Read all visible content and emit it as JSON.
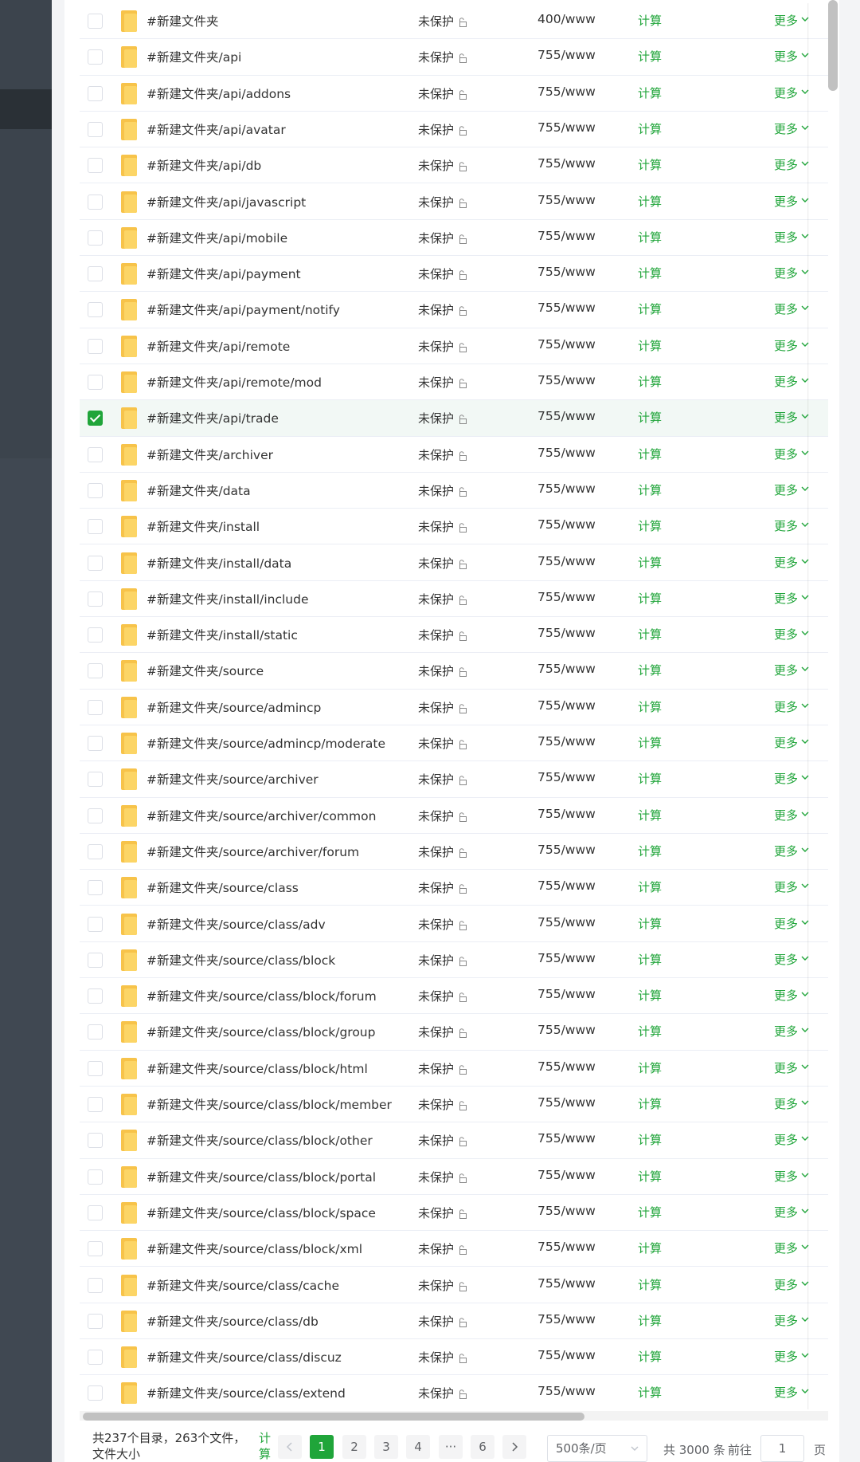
{
  "rows": [
    {
      "name": "#新建文件夹",
      "protection": "未保护",
      "permission": "400/www",
      "calc": "计算",
      "more": "更多",
      "checked": false
    },
    {
      "name": "#新建文件夹/api",
      "protection": "未保护",
      "permission": "755/www",
      "calc": "计算",
      "more": "更多",
      "checked": false
    },
    {
      "name": "#新建文件夹/api/addons",
      "protection": "未保护",
      "permission": "755/www",
      "calc": "计算",
      "more": "更多",
      "checked": false
    },
    {
      "name": "#新建文件夹/api/avatar",
      "protection": "未保护",
      "permission": "755/www",
      "calc": "计算",
      "more": "更多",
      "checked": false
    },
    {
      "name": "#新建文件夹/api/db",
      "protection": "未保护",
      "permission": "755/www",
      "calc": "计算",
      "more": "更多",
      "checked": false
    },
    {
      "name": "#新建文件夹/api/javascript",
      "protection": "未保护",
      "permission": "755/www",
      "calc": "计算",
      "more": "更多",
      "checked": false
    },
    {
      "name": "#新建文件夹/api/mobile",
      "protection": "未保护",
      "permission": "755/www",
      "calc": "计算",
      "more": "更多",
      "checked": false
    },
    {
      "name": "#新建文件夹/api/payment",
      "protection": "未保护",
      "permission": "755/www",
      "calc": "计算",
      "more": "更多",
      "checked": false
    },
    {
      "name": "#新建文件夹/api/payment/notify",
      "protection": "未保护",
      "permission": "755/www",
      "calc": "计算",
      "more": "更多",
      "checked": false
    },
    {
      "name": "#新建文件夹/api/remote",
      "protection": "未保护",
      "permission": "755/www",
      "calc": "计算",
      "more": "更多",
      "checked": false
    },
    {
      "name": "#新建文件夹/api/remote/mod",
      "protection": "未保护",
      "permission": "755/www",
      "calc": "计算",
      "more": "更多",
      "checked": false
    },
    {
      "name": "#新建文件夹/api/trade",
      "protection": "未保护",
      "permission": "755/www",
      "calc": "计算",
      "more": "更多",
      "checked": true
    },
    {
      "name": "#新建文件夹/archiver",
      "protection": "未保护",
      "permission": "755/www",
      "calc": "计算",
      "more": "更多",
      "checked": false
    },
    {
      "name": "#新建文件夹/data",
      "protection": "未保护",
      "permission": "755/www",
      "calc": "计算",
      "more": "更多",
      "checked": false
    },
    {
      "name": "#新建文件夹/install",
      "protection": "未保护",
      "permission": "755/www",
      "calc": "计算",
      "more": "更多",
      "checked": false
    },
    {
      "name": "#新建文件夹/install/data",
      "protection": "未保护",
      "permission": "755/www",
      "calc": "计算",
      "more": "更多",
      "checked": false
    },
    {
      "name": "#新建文件夹/install/include",
      "protection": "未保护",
      "permission": "755/www",
      "calc": "计算",
      "more": "更多",
      "checked": false
    },
    {
      "name": "#新建文件夹/install/static",
      "protection": "未保护",
      "permission": "755/www",
      "calc": "计算",
      "more": "更多",
      "checked": false
    },
    {
      "name": "#新建文件夹/source",
      "protection": "未保护",
      "permission": "755/www",
      "calc": "计算",
      "more": "更多",
      "checked": false
    },
    {
      "name": "#新建文件夹/source/admincp",
      "protection": "未保护",
      "permission": "755/www",
      "calc": "计算",
      "more": "更多",
      "checked": false
    },
    {
      "name": "#新建文件夹/source/admincp/moderate",
      "protection": "未保护",
      "permission": "755/www",
      "calc": "计算",
      "more": "更多",
      "checked": false
    },
    {
      "name": "#新建文件夹/source/archiver",
      "protection": "未保护",
      "permission": "755/www",
      "calc": "计算",
      "more": "更多",
      "checked": false
    },
    {
      "name": "#新建文件夹/source/archiver/common",
      "protection": "未保护",
      "permission": "755/www",
      "calc": "计算",
      "more": "更多",
      "checked": false
    },
    {
      "name": "#新建文件夹/source/archiver/forum",
      "protection": "未保护",
      "permission": "755/www",
      "calc": "计算",
      "more": "更多",
      "checked": false
    },
    {
      "name": "#新建文件夹/source/class",
      "protection": "未保护",
      "permission": "755/www",
      "calc": "计算",
      "more": "更多",
      "checked": false
    },
    {
      "name": "#新建文件夹/source/class/adv",
      "protection": "未保护",
      "permission": "755/www",
      "calc": "计算",
      "more": "更多",
      "checked": false
    },
    {
      "name": "#新建文件夹/source/class/block",
      "protection": "未保护",
      "permission": "755/www",
      "calc": "计算",
      "more": "更多",
      "checked": false
    },
    {
      "name": "#新建文件夹/source/class/block/forum",
      "protection": "未保护",
      "permission": "755/www",
      "calc": "计算",
      "more": "更多",
      "checked": false
    },
    {
      "name": "#新建文件夹/source/class/block/group",
      "protection": "未保护",
      "permission": "755/www",
      "calc": "计算",
      "more": "更多",
      "checked": false
    },
    {
      "name": "#新建文件夹/source/class/block/html",
      "protection": "未保护",
      "permission": "755/www",
      "calc": "计算",
      "more": "更多",
      "checked": false
    },
    {
      "name": "#新建文件夹/source/class/block/member",
      "protection": "未保护",
      "permission": "755/www",
      "calc": "计算",
      "more": "更多",
      "checked": false
    },
    {
      "name": "#新建文件夹/source/class/block/other",
      "protection": "未保护",
      "permission": "755/www",
      "calc": "计算",
      "more": "更多",
      "checked": false
    },
    {
      "name": "#新建文件夹/source/class/block/portal",
      "protection": "未保护",
      "permission": "755/www",
      "calc": "计算",
      "more": "更多",
      "checked": false
    },
    {
      "name": "#新建文件夹/source/class/block/space",
      "protection": "未保护",
      "permission": "755/www",
      "calc": "计算",
      "more": "更多",
      "checked": false
    },
    {
      "name": "#新建文件夹/source/class/block/xml",
      "protection": "未保护",
      "permission": "755/www",
      "calc": "计算",
      "more": "更多",
      "checked": false
    },
    {
      "name": "#新建文件夹/source/class/cache",
      "protection": "未保护",
      "permission": "755/www",
      "calc": "计算",
      "more": "更多",
      "checked": false
    },
    {
      "name": "#新建文件夹/source/class/db",
      "protection": "未保护",
      "permission": "755/www",
      "calc": "计算",
      "more": "更多",
      "checked": false
    },
    {
      "name": "#新建文件夹/source/class/discuz",
      "protection": "未保护",
      "permission": "755/www",
      "calc": "计算",
      "more": "更多",
      "checked": false
    },
    {
      "name": "#新建文件夹/source/class/extend",
      "protection": "未保护",
      "permission": "755/www",
      "calc": "计算",
      "more": "更多",
      "checked": false
    }
  ],
  "icons": {
    "folder": "folder-icon",
    "lock": "unlock-icon",
    "chevron": "chevron-down-icon",
    "check": "checkmark-icon"
  },
  "colors": {
    "accent": "#20a53a",
    "sidebar": "#3c444d",
    "folder": "#f7c34a"
  },
  "footer": {
    "summary": "共237个目录，263个文件，文件大小",
    "summary_calc": "计算",
    "pages": [
      "1",
      "2",
      "3",
      "4",
      "6"
    ],
    "ellipsis": "···",
    "current_page": "1",
    "page_size": "500条/页",
    "total": "共 3000 条",
    "goto_label": "前往",
    "goto_value": "1",
    "page_unit": "页"
  }
}
